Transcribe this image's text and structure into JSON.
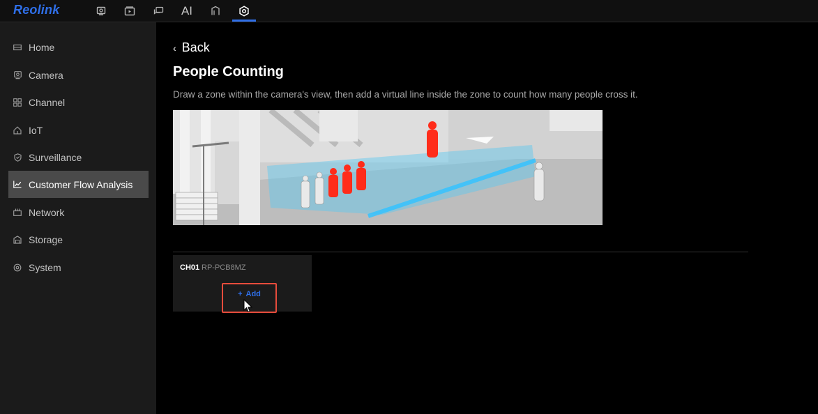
{
  "app": {
    "logo": "Reolink"
  },
  "topnav": {
    "items": [
      {
        "name": "camera-view-icon"
      },
      {
        "name": "playback-icon"
      },
      {
        "name": "messages-icon"
      },
      {
        "name": "ai",
        "label": "AI"
      },
      {
        "name": "device-icon"
      },
      {
        "name": "settings-icon"
      }
    ],
    "active": "settings-icon"
  },
  "sidebar": {
    "items": [
      {
        "label": "Home",
        "icon": "home-icon"
      },
      {
        "label": "Camera",
        "icon": "camera-icon"
      },
      {
        "label": "Channel",
        "icon": "channel-icon"
      },
      {
        "label": "IoT",
        "icon": "iot-icon"
      },
      {
        "label": "Surveillance",
        "icon": "shield-icon"
      },
      {
        "label": "Customer Flow Analysis",
        "icon": "chart-icon"
      },
      {
        "label": "Network",
        "icon": "network-icon"
      },
      {
        "label": "Storage",
        "icon": "storage-icon"
      },
      {
        "label": "System",
        "icon": "gear-icon"
      }
    ],
    "active_index": 5
  },
  "main": {
    "back_label": "Back",
    "title": "People Counting",
    "description": "Draw a zone within the camera's view, then add a virtual line inside the zone to count how many people cross it.",
    "channel_card": {
      "channel": "CH01",
      "model": "RP-PCB8MZ",
      "add_label": "Add"
    }
  },
  "colors": {
    "accent": "#2f6fe8",
    "highlight_border": "#e74c3c",
    "sidebar_bg": "#1b1b1b",
    "sidebar_active": "#4a4a4a"
  }
}
